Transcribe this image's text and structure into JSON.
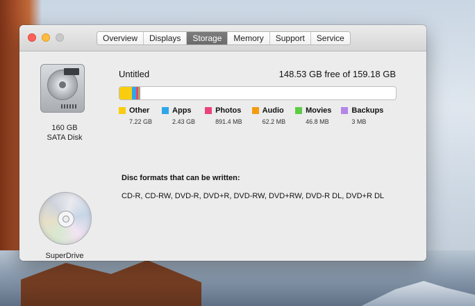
{
  "window": {
    "tabs": [
      {
        "label": "Overview",
        "active": false
      },
      {
        "label": "Displays",
        "active": false
      },
      {
        "label": "Storage",
        "active": true
      },
      {
        "label": "Memory",
        "active": false
      },
      {
        "label": "Support",
        "active": false
      },
      {
        "label": "Service",
        "active": false
      }
    ]
  },
  "disk": {
    "capacity": "160 GB",
    "type": "SATA Disk",
    "volume_name": "Untitled",
    "free_text": "148.53 GB free of 159.18 GB",
    "usage": [
      {
        "name": "Other",
        "size": "7.22 GB",
        "color": "#f9cd0e",
        "fraction": 0.045
      },
      {
        "name": "Apps",
        "size": "2.43 GB",
        "color": "#2ea7e8",
        "fraction": 0.016
      },
      {
        "name": "Photos",
        "size": "891.4 MB",
        "color": "#e9447a",
        "fraction": 0.006
      },
      {
        "name": "Audio",
        "size": "62.2 MB",
        "color": "#f39c12",
        "fraction": 0.003
      },
      {
        "name": "Movies",
        "size": "46.8 MB",
        "color": "#5ccc46",
        "fraction": 0.003
      },
      {
        "name": "Backups",
        "size": "3 MB",
        "color": "#b386e8",
        "fraction": 0.002
      }
    ]
  },
  "optical": {
    "name": "SuperDrive",
    "formats_title": "Disc formats that can be written:",
    "formats": "CD-R, CD-RW, DVD-R, DVD+R, DVD-RW, DVD+RW, DVD-R DL, DVD+R DL"
  },
  "icons": {
    "hard-disk": "hard-disk-icon",
    "optical-disc": "optical-disc-icon"
  }
}
